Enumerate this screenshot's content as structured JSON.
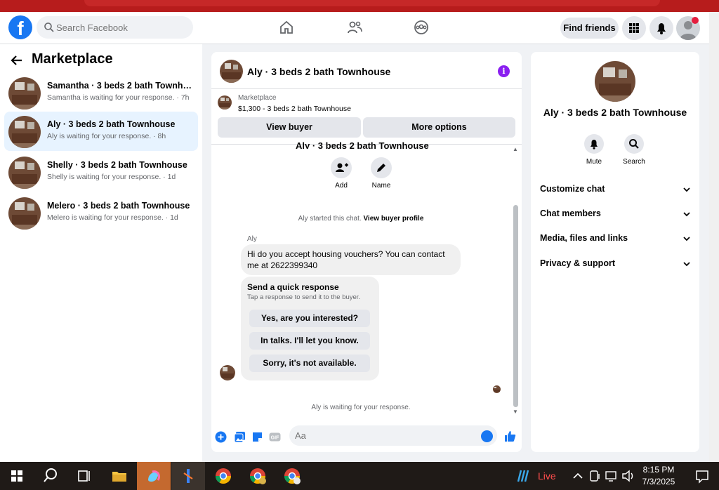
{
  "topnav": {
    "logo": "f",
    "search_placeholder": "Search Facebook",
    "find_friends": "Find friends"
  },
  "sidebar": {
    "title": "Marketplace",
    "conversations": [
      {
        "name": "Samantha · 3 beds 2 bath Townho...",
        "sub": "Samantha is waiting for your response. · 7h"
      },
      {
        "name": "Aly · 3 beds 2 bath Townhouse",
        "sub": "Aly is waiting for your response. · 8h"
      },
      {
        "name": "Shelly · 3 beds 2 bath Townhouse",
        "sub": "Shelly is waiting for your response. · 1d"
      },
      {
        "name": "Melero · 3 beds 2 bath Townhouse",
        "sub": "Melero is waiting for your response. · 1d"
      }
    ]
  },
  "chat": {
    "title": "Aly · 3 beds 2 bath Townhouse",
    "info_glyph": "i",
    "marketplace_label": "Marketplace",
    "listing": "$1,300 - 3 beds 2 bath Townhouse",
    "view_buyer": "View buyer",
    "more_options": "More options",
    "cut_title": "Aly · 3 beds 2 bath Townhouse",
    "add_label": "Add",
    "name_label": "Name",
    "started_text": "Aly started this chat.",
    "view_profile": "View buyer profile",
    "sender": "Aly",
    "message": "Hi do you accept housing vouchers? You can contact me at 2622399340",
    "quick_title": "Send a quick response",
    "quick_sub": "Tap a response to send it to the buyer.",
    "quick_options": [
      "Yes, are you interested?",
      "In talks. I'll let you know.",
      "Sorry, it's not available."
    ],
    "waiting": "Aly is waiting for your response.",
    "composer_placeholder": "Aa"
  },
  "details": {
    "title": "Aly · 3 beds 2 bath Townhouse",
    "mute": "Mute",
    "search": "Search",
    "sections": [
      "Customize chat",
      "Chat members",
      "Media, files and links",
      "Privacy & support"
    ]
  },
  "taskbar": {
    "weather": "Live",
    "time": "8:15 PM",
    "date": "7/3/2025"
  },
  "colors": {
    "brand": "#1877f2",
    "info": "#8a1ff0",
    "notification": "#e41e3f"
  }
}
